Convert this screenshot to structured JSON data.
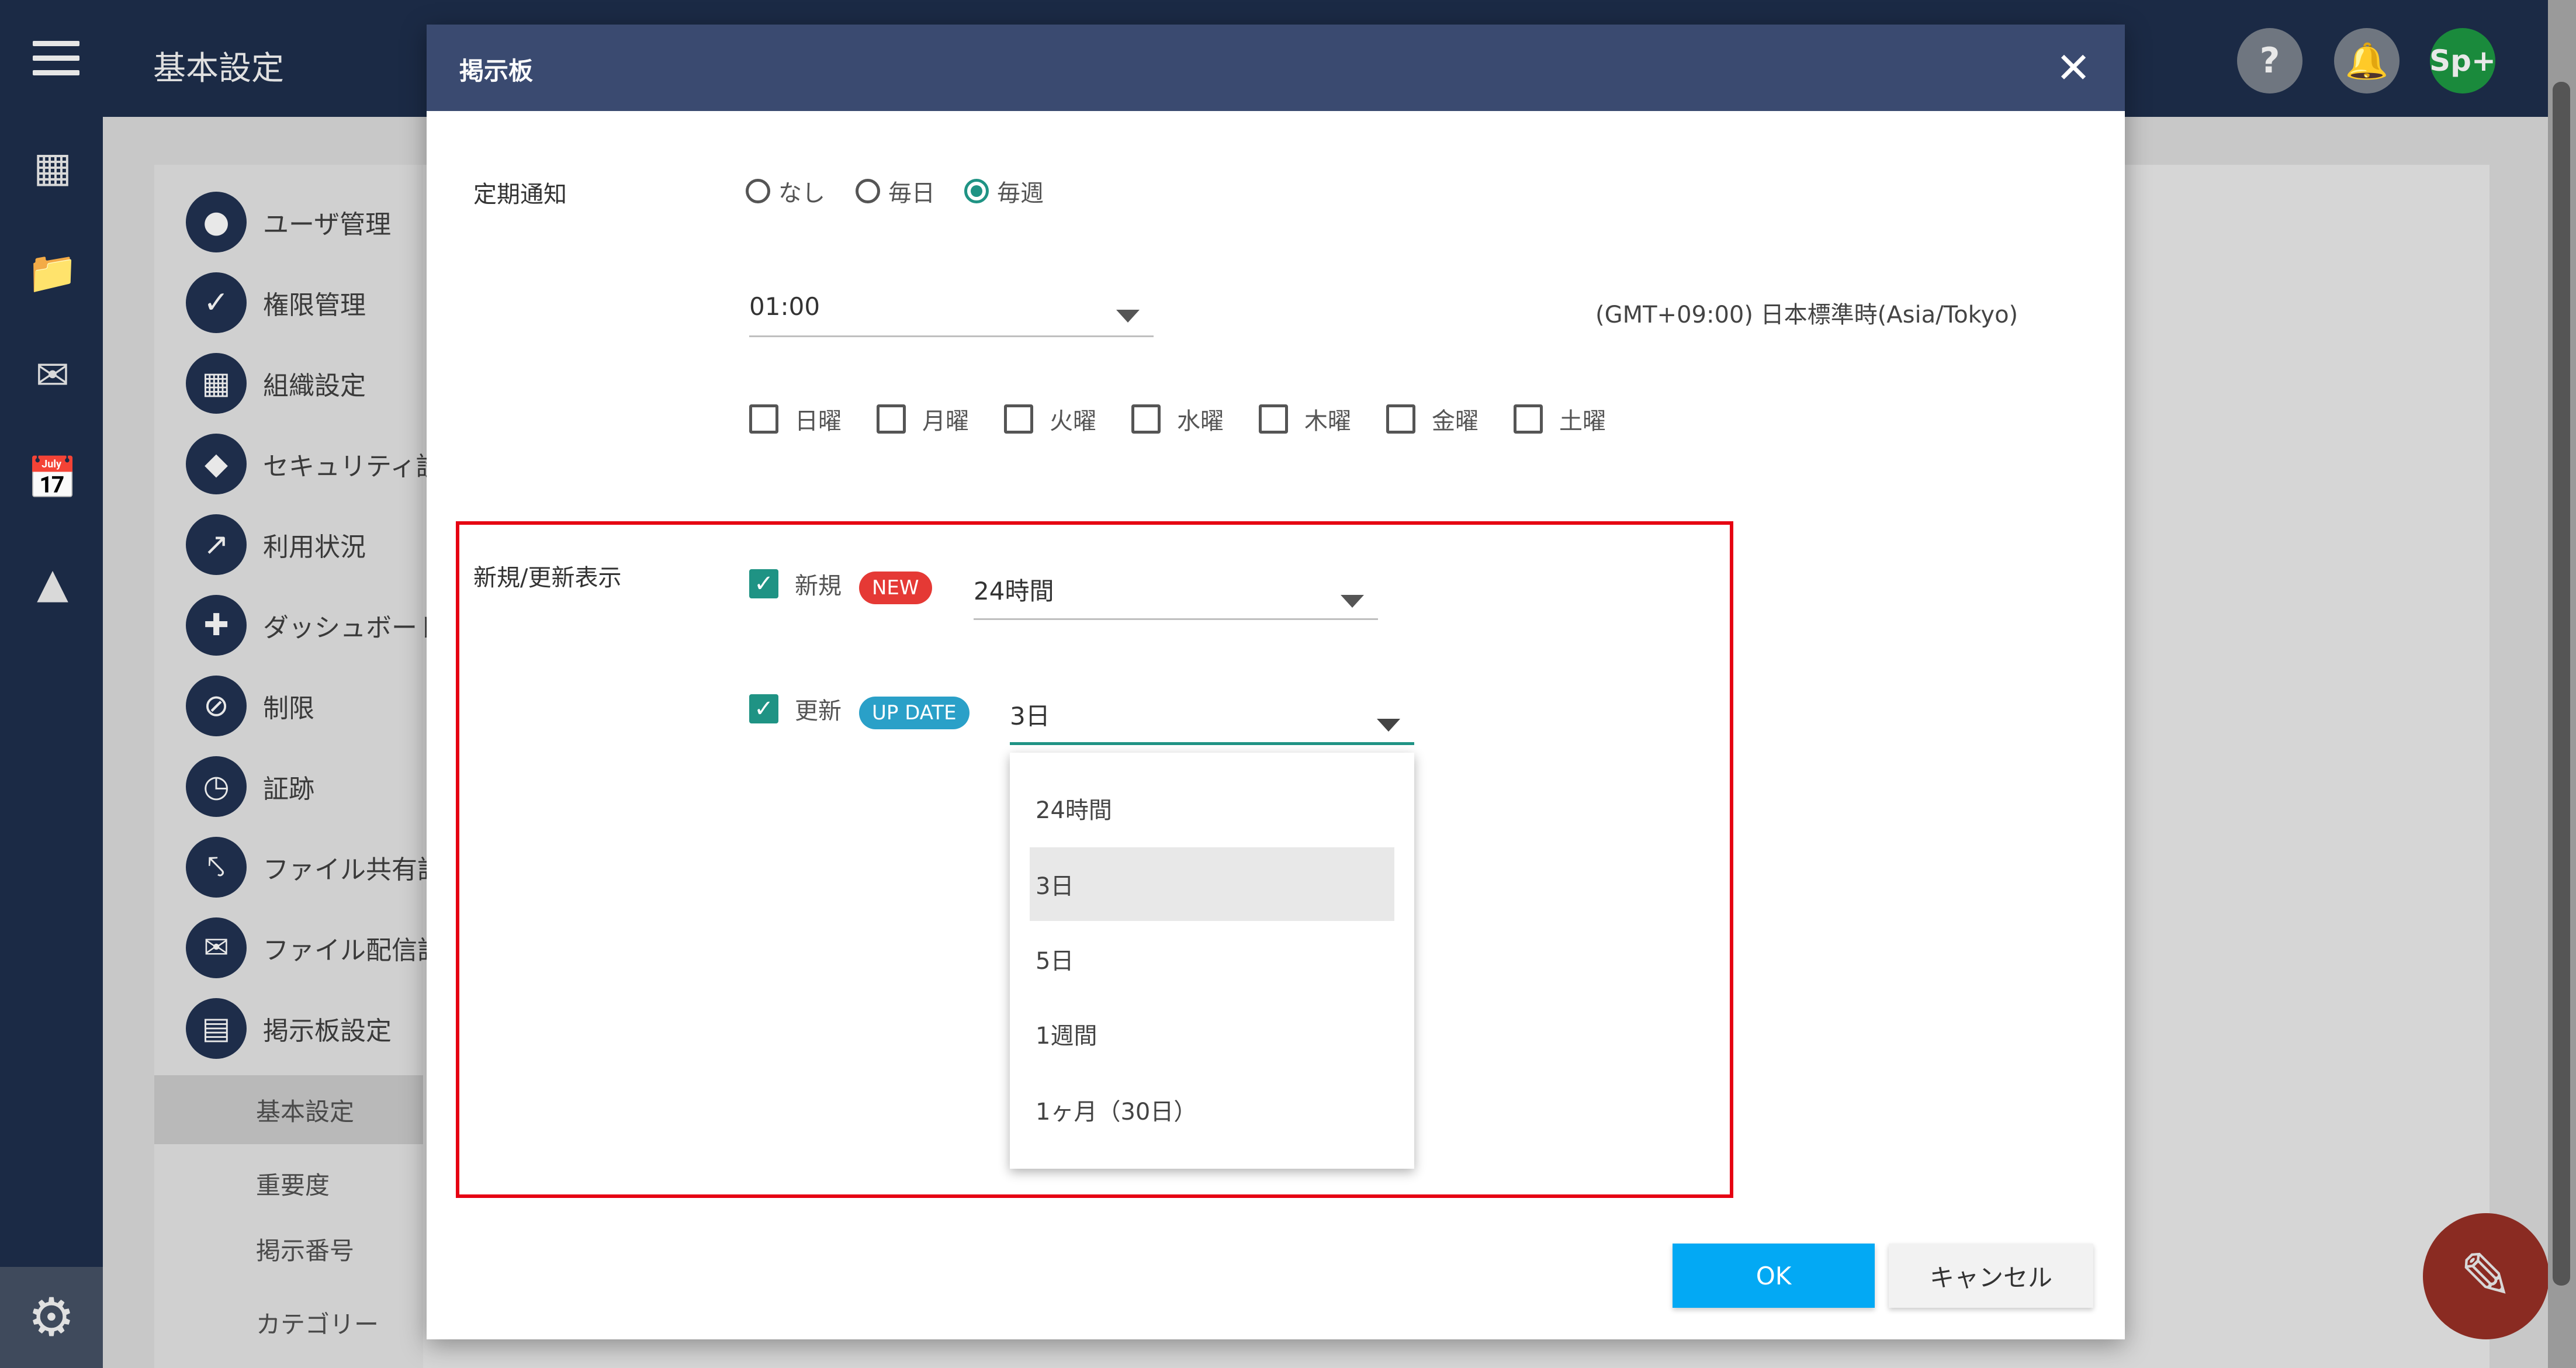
{
  "app": {
    "title": "基本設定",
    "avatar_text": "Sp+",
    "help_label": "?",
    "settings_menu": [
      {
        "label": "ユーザ管理",
        "icon": "person-icon"
      },
      {
        "label": "権限管理",
        "icon": "shield-check-icon"
      },
      {
        "label": "組織設定",
        "icon": "building-icon"
      },
      {
        "label": "セキュリティ設",
        "icon": "security-icon"
      },
      {
        "label": "利用状況",
        "icon": "chart-icon"
      },
      {
        "label": "ダッシュボード",
        "icon": "dashboard-icon"
      },
      {
        "label": "制限",
        "icon": "block-icon"
      },
      {
        "label": "証跡",
        "icon": "clock-icon"
      },
      {
        "label": "ファイル共有設",
        "icon": "share-icon"
      },
      {
        "label": "ファイル配信設",
        "icon": "mail-icon"
      },
      {
        "label": "掲示板設定",
        "icon": "board-icon"
      }
    ],
    "sub_items": [
      "基本設定",
      "重要度",
      "掲示番号",
      "カテゴリー"
    ]
  },
  "dialog": {
    "title": "掲示板",
    "periodic_notice": {
      "label": "定期通知",
      "options": [
        "なし",
        "毎日",
        "毎週"
      ],
      "selected": "毎週",
      "time": "01:00",
      "timezone": "(GMT+09:00) 日本標準時(Asia/Tokyo)",
      "days": [
        "日曜",
        "月曜",
        "火曜",
        "水曜",
        "木曜",
        "金曜",
        "土曜"
      ]
    },
    "new_update": {
      "label": "新規/更新表示",
      "new_label": "新規",
      "new_badge": "NEW",
      "new_value": "24時間",
      "update_label": "更新",
      "update_badge": "UP DATE",
      "update_value": "3日",
      "dropdown_options": [
        "24時間",
        "3日",
        "5日",
        "1週間",
        "1ヶ月（30日）"
      ],
      "dropdown_selected": "3日"
    },
    "ok_label": "OK",
    "cancel_label": "キャンセル"
  },
  "colors": {
    "accent": "#1f9384",
    "header": "#3a4a70",
    "ok": "#03a9f4",
    "highlight": "#e60012"
  }
}
